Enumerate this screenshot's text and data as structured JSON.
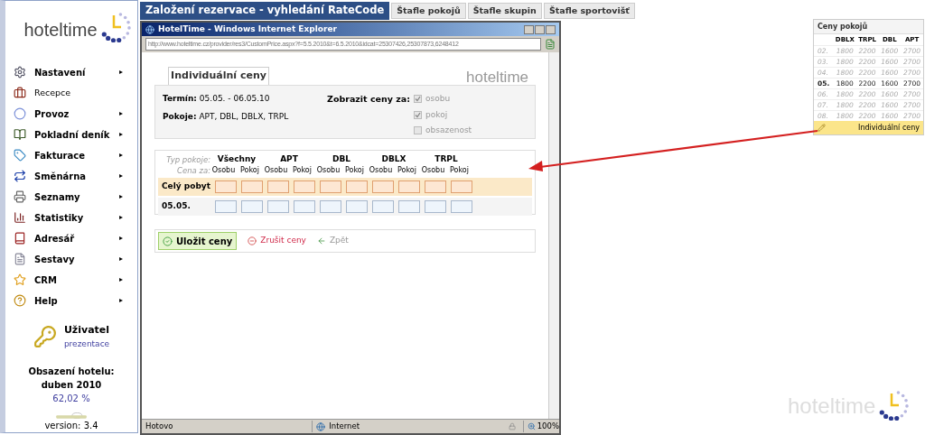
{
  "sidebar": {
    "logo": "hoteltime",
    "items": [
      {
        "label": "Nastavení",
        "kind": "menu",
        "arrow": "▸"
      },
      {
        "label": "Recepce",
        "kind": "link"
      },
      {
        "label": "Provoz",
        "kind": "menu",
        "arrow": "▸"
      },
      {
        "label": "Pokladní deník",
        "kind": "menu",
        "arrow": "▸"
      },
      {
        "label": "Fakturace",
        "kind": "menu",
        "arrow": "▸"
      },
      {
        "label": "Směnárna",
        "kind": "menu",
        "arrow": "▸"
      },
      {
        "label": "Seznamy",
        "kind": "menu",
        "arrow": "▸"
      },
      {
        "label": "Statistiky",
        "kind": "menu",
        "arrow": "▸"
      },
      {
        "label": "Adresář",
        "kind": "menu",
        "arrow": "▸"
      },
      {
        "label": "Sestavy",
        "kind": "menu",
        "arrow": "▸"
      },
      {
        "label": "CRM",
        "kind": "menu",
        "arrow": "▸"
      },
      {
        "label": "Help",
        "kind": "menu",
        "arrow": "▸"
      }
    ],
    "user": {
      "label": "Uživatel",
      "name": "prezentace"
    },
    "occupancy": {
      "title": "Obsazení hotelu:",
      "month": "duben 2010",
      "value": "62,02 %"
    },
    "version": "version: 3.4"
  },
  "tabs": [
    {
      "label": "Založení rezervace - vyhledání RateCode",
      "selected": true
    },
    {
      "label": "Štafle pokojů",
      "selected": false
    },
    {
      "label": "Štafle skupin",
      "selected": false
    },
    {
      "label": "Štafle sportovišť",
      "selected": false
    }
  ],
  "window": {
    "title": "HotelTime - Windows Internet Explorer",
    "address": "http://www.hoteltime.cz/provider/res3/CustomPrice.aspx?f=5.5.2010&t=6.5.2010&idcat=25307426,25307873,6248412",
    "logo": "hoteltime",
    "tab": "Individuální ceny",
    "info": {
      "term_label": "Termín:",
      "term": "05.05. - 06.05.10",
      "rooms_label": "Pokoje:",
      "rooms": "APT, DBL, DBLX, TRPL",
      "show_label": "Zobrazit ceny za:",
      "options": [
        {
          "label": "osobu",
          "checked": true,
          "disabled": true
        },
        {
          "label": "pokoj",
          "checked": true,
          "disabled": true
        },
        {
          "label": "obsazenost",
          "checked": false,
          "disabled": true
        }
      ]
    },
    "grid": {
      "type_label": "Typ pokoje:",
      "price_label": "Cena za:",
      "groups": [
        {
          "label": "Všechny",
          "sub": [
            "Osobu",
            "Pokoj"
          ]
        },
        {
          "label": "APT",
          "sub": [
            "Osobu",
            "Pokoj"
          ]
        },
        {
          "label": "DBL",
          "sub": [
            "Osobu",
            "Pokoj"
          ]
        },
        {
          "label": "DBLX",
          "sub": [
            "Osobu",
            "Pokoj"
          ]
        },
        {
          "label": "TRPL",
          "sub": [
            "Osobu",
            "Pokoj"
          ]
        }
      ],
      "rows": [
        {
          "label": "Celý pobyt",
          "kind": "total"
        },
        {
          "label": "05.05.",
          "kind": "day"
        }
      ]
    },
    "buttons": [
      {
        "label": "Uložit ceny",
        "kind": "save"
      },
      {
        "label": "Zrušit ceny",
        "kind": "cancel"
      },
      {
        "label": "Zpět",
        "kind": "back"
      }
    ],
    "status": {
      "text": "Hotovo",
      "zone": "Internet",
      "zoom": "100%"
    }
  },
  "price_panel": {
    "title": "Ceny pokojů",
    "columns": [
      "DBLX",
      "TRPL",
      "DBL",
      "APT"
    ],
    "rows": [
      {
        "day": "02.",
        "values": [
          "1800",
          "2200",
          "1600",
          "2700"
        ],
        "selected": false
      },
      {
        "day": "03.",
        "values": [
          "1800",
          "2200",
          "1600",
          "2700"
        ],
        "selected": false
      },
      {
        "day": "04.",
        "values": [
          "1800",
          "2200",
          "1600",
          "2700"
        ],
        "selected": false
      },
      {
        "day": "05.",
        "values": [
          "1800",
          "2200",
          "1600",
          "2700"
        ],
        "selected": true
      },
      {
        "day": "06.",
        "values": [
          "1800",
          "2200",
          "1600",
          "2700"
        ],
        "selected": false
      },
      {
        "day": "07.",
        "values": [
          "1800",
          "2200",
          "1600",
          "2700"
        ],
        "selected": false
      },
      {
        "day": "08.",
        "values": [
          "1800",
          "2200",
          "1600",
          "2700"
        ],
        "selected": false
      }
    ],
    "action": "Individuální ceny"
  },
  "footer_logo": "hoteltime"
}
